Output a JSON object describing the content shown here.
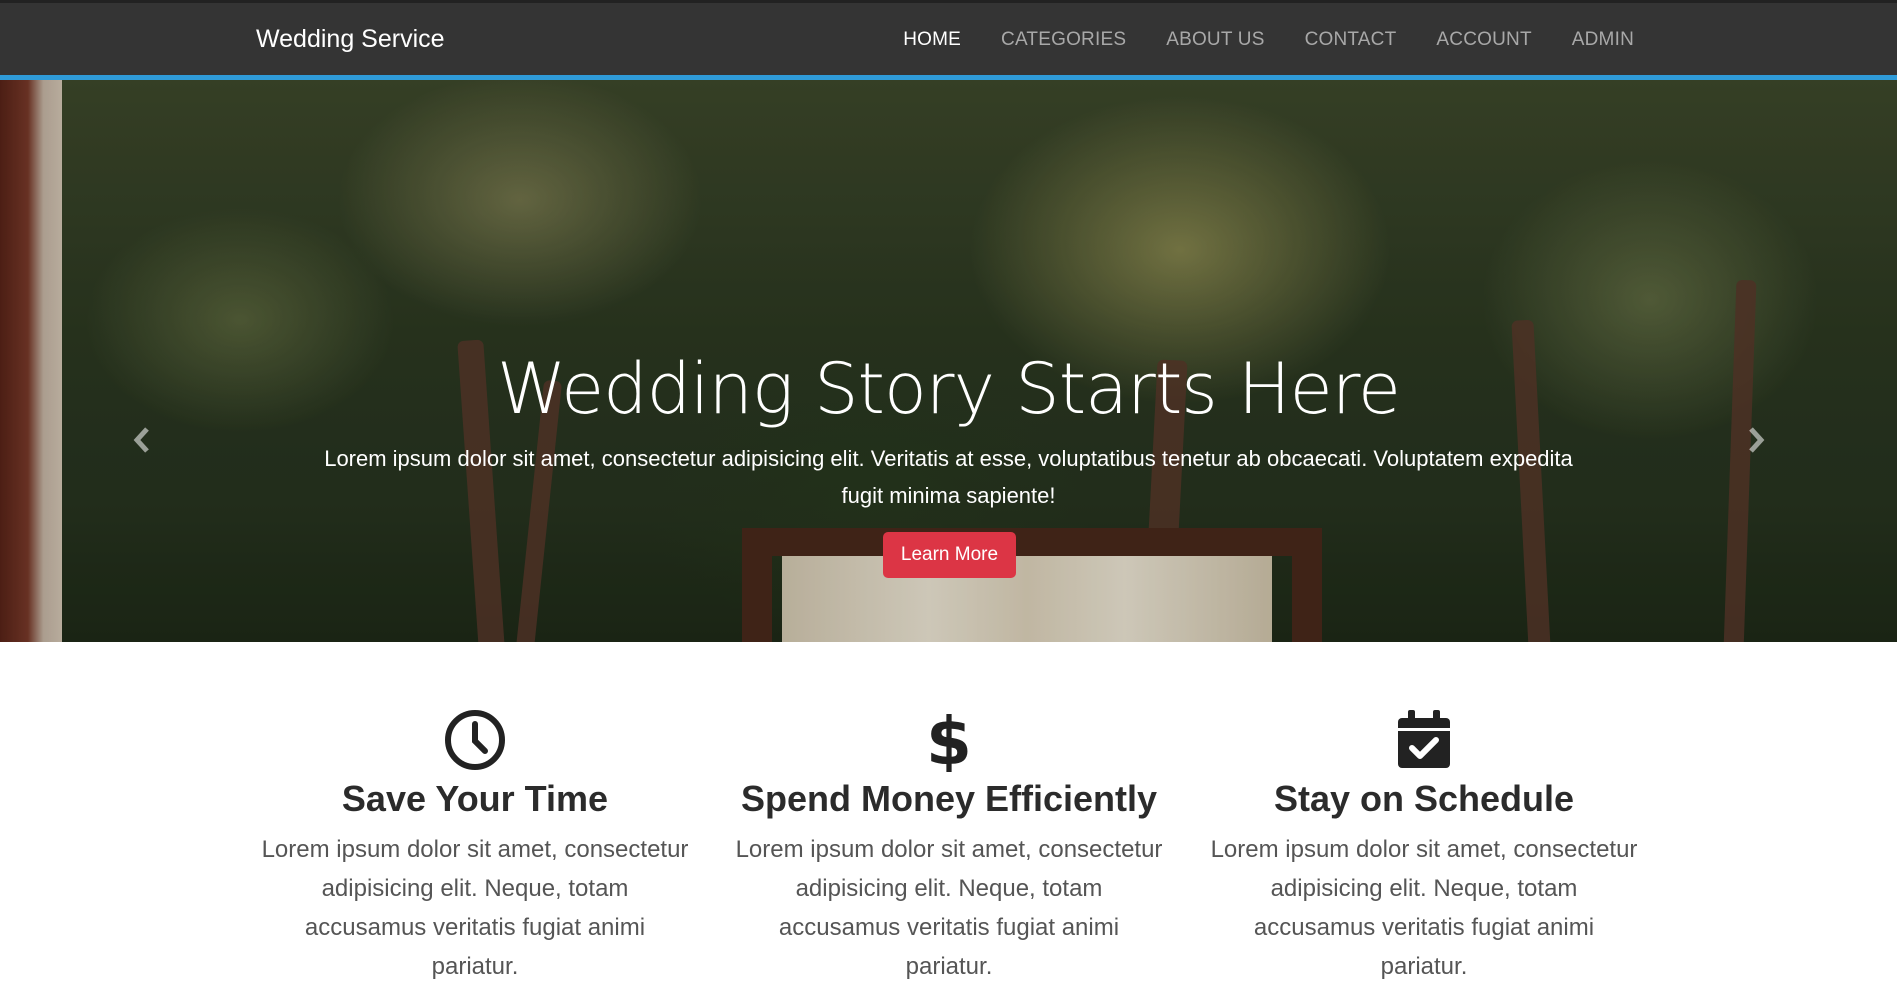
{
  "nav": {
    "brand": "Wedding Service",
    "links": [
      {
        "label": "HOME",
        "active": true
      },
      {
        "label": "CATEGORIES",
        "active": false
      },
      {
        "label": "ABOUT US",
        "active": false
      },
      {
        "label": "CONTACT",
        "active": false
      },
      {
        "label": "ACCOUNT",
        "active": false
      },
      {
        "label": "ADMIN",
        "active": false
      }
    ],
    "accent_color": "#2f9bd8"
  },
  "hero": {
    "title": "Wedding Story Starts Here",
    "text": "Lorem ipsum dolor sit amet, consectetur adipisicing elit. Veritatis at esse, voluptatibus tenetur ab obcaecati. Voluptatem expedita fugit minima sapiente!",
    "button_label": "Learn More",
    "button_color": "#dc3545",
    "prev_icon": "chevron-left-icon",
    "next_icon": "chevron-right-icon",
    "slide_count": 3,
    "active_slide": 1
  },
  "features": [
    {
      "icon": "clock-icon",
      "title": "Save Your Time",
      "text": "Lorem ipsum dolor sit amet, consectetur adipisicing elit. Neque, totam accusamus veritatis fugiat animi pariatur."
    },
    {
      "icon": "dollar-icon",
      "title": "Spend Money Efficiently",
      "text": "Lorem ipsum dolor sit amet, consectetur adipisicing elit. Neque, totam accusamus veritatis fugiat animi pariatur."
    },
    {
      "icon": "calendar-check-icon",
      "title": "Stay on Schedule",
      "text": "Lorem ipsum dolor sit amet, consectetur adipisicing elit. Neque, totam accusamus veritatis fugiat animi pariatur."
    }
  ]
}
